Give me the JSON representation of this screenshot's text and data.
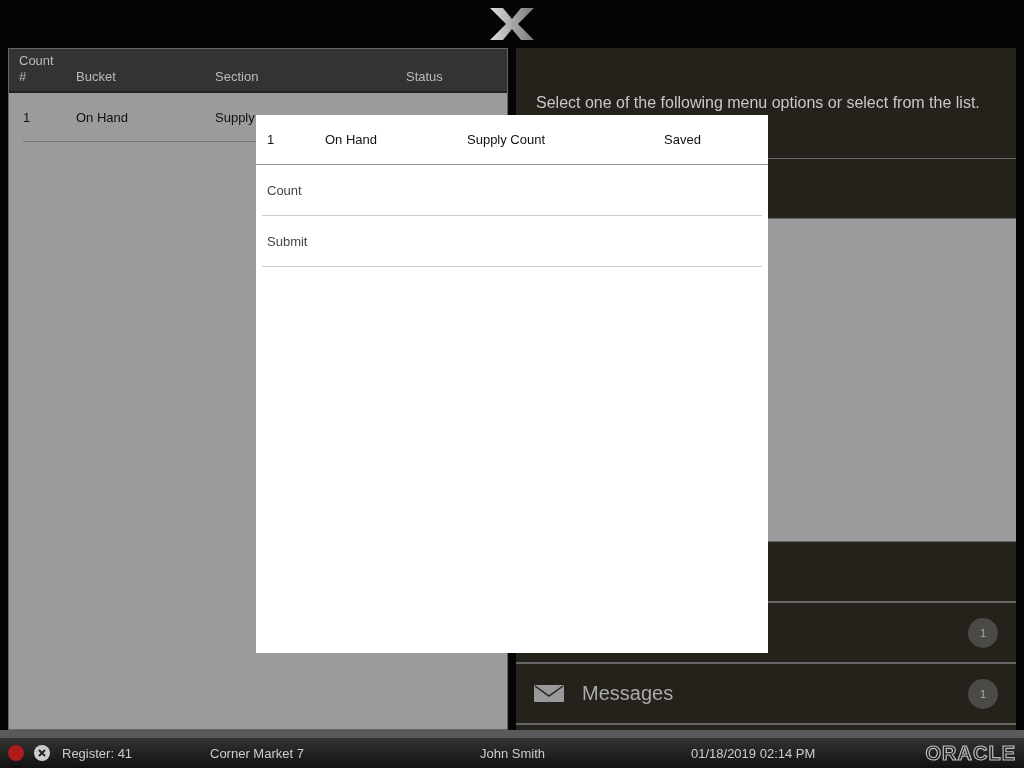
{
  "table": {
    "columns": [
      "Count\n#",
      "Bucket",
      "Section",
      "Status"
    ],
    "rows": [
      {
        "cells": [
          "1",
          "On Hand",
          "Supply"
        ]
      }
    ]
  },
  "prompt": "Select one of the following menu options or select from the list.",
  "menu_top": [
    {
      "kind": "blank"
    }
  ],
  "menu_bottom": [
    {
      "kind": "blank"
    },
    {
      "kind": "blank",
      "badge": "1"
    },
    {
      "kind": "labeled",
      "label": "Messages",
      "badge": "1"
    },
    {
      "kind": "blank"
    }
  ],
  "modal": {
    "header": [
      "1",
      "On Hand",
      "Supply Count",
      "Saved"
    ],
    "options": [
      "Count",
      "Submit"
    ]
  },
  "status_bar": {
    "register": "Register: 41",
    "store": "Corner Market 7",
    "user": "John Smith",
    "datetime": "01/18/2019 02:14 PM",
    "brand": "ORACLE"
  }
}
